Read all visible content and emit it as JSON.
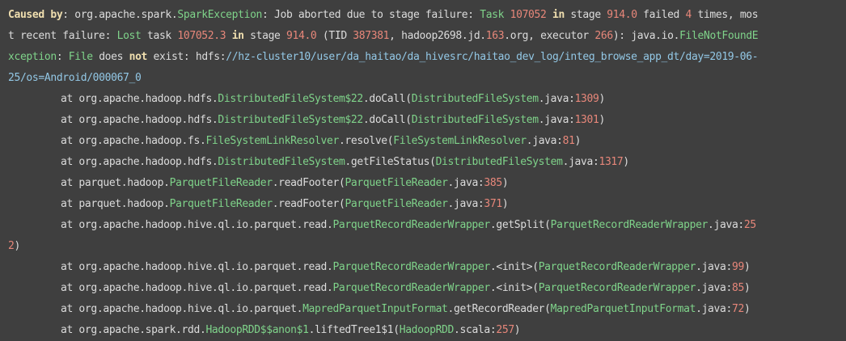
{
  "lines": [
    {
      "indent": false,
      "tokens": [
        {
          "t": "Caused by",
          "c": "kw"
        },
        {
          "t": ": org.apache.spark.",
          "c": "plain"
        },
        {
          "t": "SparkException",
          "c": "cls"
        },
        {
          "t": ": Job aborted due to stage failure: ",
          "c": "plain"
        },
        {
          "t": "Task",
          "c": "cls"
        },
        {
          "t": " ",
          "c": "plain"
        },
        {
          "t": "107052",
          "c": "num"
        },
        {
          "t": " ",
          "c": "plain"
        },
        {
          "t": "in",
          "c": "kw"
        },
        {
          "t": " stage ",
          "c": "plain"
        },
        {
          "t": "914.0",
          "c": "num"
        },
        {
          "t": " failed ",
          "c": "plain"
        },
        {
          "t": "4",
          "c": "num"
        },
        {
          "t": " times, mos",
          "c": "plain"
        }
      ]
    },
    {
      "indent": false,
      "tokens": [
        {
          "t": "t recent failure: ",
          "c": "plain"
        },
        {
          "t": "Lost",
          "c": "cls"
        },
        {
          "t": " task ",
          "c": "plain"
        },
        {
          "t": "107052.3",
          "c": "num"
        },
        {
          "t": " ",
          "c": "plain"
        },
        {
          "t": "in",
          "c": "kw"
        },
        {
          "t": " stage ",
          "c": "plain"
        },
        {
          "t": "914.0",
          "c": "num"
        },
        {
          "t": " (TID ",
          "c": "plain"
        },
        {
          "t": "387381",
          "c": "num"
        },
        {
          "t": ", hadoop2698.jd.",
          "c": "plain"
        },
        {
          "t": "163",
          "c": "num"
        },
        {
          "t": ".org, executor ",
          "c": "plain"
        },
        {
          "t": "266",
          "c": "num"
        },
        {
          "t": "): java.io.",
          "c": "plain"
        },
        {
          "t": "FileNotFoundE",
          "c": "cls"
        }
      ]
    },
    {
      "indent": false,
      "tokens": [
        {
          "t": "xception",
          "c": "cls"
        },
        {
          "t": ": ",
          "c": "plain"
        },
        {
          "t": "File",
          "c": "cls"
        },
        {
          "t": " does ",
          "c": "plain"
        },
        {
          "t": "not",
          "c": "kw"
        },
        {
          "t": " exist: hdfs:",
          "c": "plain"
        },
        {
          "t": "//hz-cluster10/user/da_haitao/da_hivesrc/haitao_dev_log/integ_browse_app_dt/day=2019-06-",
          "c": "path"
        }
      ]
    },
    {
      "indent": false,
      "tokens": [
        {
          "t": "25/os=Android/000067_0",
          "c": "path"
        }
      ]
    },
    {
      "indent": true,
      "tokens": [
        {
          "t": "at org.apache.hadoop.hdfs.",
          "c": "plain"
        },
        {
          "t": "DistributedFileSystem$22",
          "c": "cls"
        },
        {
          "t": ".doCall(",
          "c": "plain"
        },
        {
          "t": "DistributedFileSystem",
          "c": "cls"
        },
        {
          "t": ".java:",
          "c": "plain"
        },
        {
          "t": "1309",
          "c": "num"
        },
        {
          "t": ")",
          "c": "plain"
        }
      ]
    },
    {
      "indent": true,
      "tokens": [
        {
          "t": "at org.apache.hadoop.hdfs.",
          "c": "plain"
        },
        {
          "t": "DistributedFileSystem$22",
          "c": "cls"
        },
        {
          "t": ".doCall(",
          "c": "plain"
        },
        {
          "t": "DistributedFileSystem",
          "c": "cls"
        },
        {
          "t": ".java:",
          "c": "plain"
        },
        {
          "t": "1301",
          "c": "num"
        },
        {
          "t": ")",
          "c": "plain"
        }
      ]
    },
    {
      "indent": true,
      "tokens": [
        {
          "t": "at org.apache.hadoop.fs.",
          "c": "plain"
        },
        {
          "t": "FileSystemLinkResolver",
          "c": "cls"
        },
        {
          "t": ".resolve(",
          "c": "plain"
        },
        {
          "t": "FileSystemLinkResolver",
          "c": "cls"
        },
        {
          "t": ".java:",
          "c": "plain"
        },
        {
          "t": "81",
          "c": "num"
        },
        {
          "t": ")",
          "c": "plain"
        }
      ]
    },
    {
      "indent": true,
      "tokens": [
        {
          "t": "at org.apache.hadoop.hdfs.",
          "c": "plain"
        },
        {
          "t": "DistributedFileSystem",
          "c": "cls"
        },
        {
          "t": ".getFileStatus(",
          "c": "plain"
        },
        {
          "t": "DistributedFileSystem",
          "c": "cls"
        },
        {
          "t": ".java:",
          "c": "plain"
        },
        {
          "t": "1317",
          "c": "num"
        },
        {
          "t": ")",
          "c": "plain"
        }
      ]
    },
    {
      "indent": true,
      "tokens": [
        {
          "t": "at parquet.hadoop.",
          "c": "plain"
        },
        {
          "t": "ParquetFileReader",
          "c": "cls"
        },
        {
          "t": ".readFooter(",
          "c": "plain"
        },
        {
          "t": "ParquetFileReader",
          "c": "cls"
        },
        {
          "t": ".java:",
          "c": "plain"
        },
        {
          "t": "385",
          "c": "num"
        },
        {
          "t": ")",
          "c": "plain"
        }
      ]
    },
    {
      "indent": true,
      "tokens": [
        {
          "t": "at parquet.hadoop.",
          "c": "plain"
        },
        {
          "t": "ParquetFileReader",
          "c": "cls"
        },
        {
          "t": ".readFooter(",
          "c": "plain"
        },
        {
          "t": "ParquetFileReader",
          "c": "cls"
        },
        {
          "t": ".java:",
          "c": "plain"
        },
        {
          "t": "371",
          "c": "num"
        },
        {
          "t": ")",
          "c": "plain"
        }
      ]
    },
    {
      "indent": true,
      "tokens": [
        {
          "t": "at org.apache.hadoop.hive.ql.io.parquet.read.",
          "c": "plain"
        },
        {
          "t": "ParquetRecordReaderWrapper",
          "c": "cls"
        },
        {
          "t": ".getSplit(",
          "c": "plain"
        },
        {
          "t": "ParquetRecordReaderWrapper",
          "c": "cls"
        },
        {
          "t": ".java:",
          "c": "plain"
        },
        {
          "t": "25",
          "c": "num"
        }
      ]
    },
    {
      "indent": false,
      "tokens": [
        {
          "t": "2",
          "c": "num"
        },
        {
          "t": ")",
          "c": "plain"
        }
      ]
    },
    {
      "indent": true,
      "tokens": [
        {
          "t": "at org.apache.hadoop.hive.ql.io.parquet.read.",
          "c": "plain"
        },
        {
          "t": "ParquetRecordReaderWrapper",
          "c": "cls"
        },
        {
          "t": ".<init>(",
          "c": "plain"
        },
        {
          "t": "ParquetRecordReaderWrapper",
          "c": "cls"
        },
        {
          "t": ".java:",
          "c": "plain"
        },
        {
          "t": "99",
          "c": "num"
        },
        {
          "t": ")",
          "c": "plain"
        }
      ]
    },
    {
      "indent": true,
      "tokens": [
        {
          "t": "at org.apache.hadoop.hive.ql.io.parquet.read.",
          "c": "plain"
        },
        {
          "t": "ParquetRecordReaderWrapper",
          "c": "cls"
        },
        {
          "t": ".<init>(",
          "c": "plain"
        },
        {
          "t": "ParquetRecordReaderWrapper",
          "c": "cls"
        },
        {
          "t": ".java:",
          "c": "plain"
        },
        {
          "t": "85",
          "c": "num"
        },
        {
          "t": ")",
          "c": "plain"
        }
      ]
    },
    {
      "indent": true,
      "tokens": [
        {
          "t": "at org.apache.hadoop.hive.ql.io.parquet.",
          "c": "plain"
        },
        {
          "t": "MapredParquetInputFormat",
          "c": "cls"
        },
        {
          "t": ".getRecordReader(",
          "c": "plain"
        },
        {
          "t": "MapredParquetInputFormat",
          "c": "cls"
        },
        {
          "t": ".java:",
          "c": "plain"
        },
        {
          "t": "72",
          "c": "num"
        },
        {
          "t": ")",
          "c": "plain"
        }
      ]
    },
    {
      "indent": true,
      "tokens": [
        {
          "t": "at org.apache.spark.rdd.",
          "c": "plain"
        },
        {
          "t": "HadoopRDD$$anon$1",
          "c": "cls"
        },
        {
          "t": ".liftedTree1$1(",
          "c": "plain"
        },
        {
          "t": "HadoopRDD",
          "c": "cls"
        },
        {
          "t": ".scala:",
          "c": "plain"
        },
        {
          "t": "257",
          "c": "num"
        },
        {
          "t": ")",
          "c": "plain"
        }
      ]
    }
  ]
}
